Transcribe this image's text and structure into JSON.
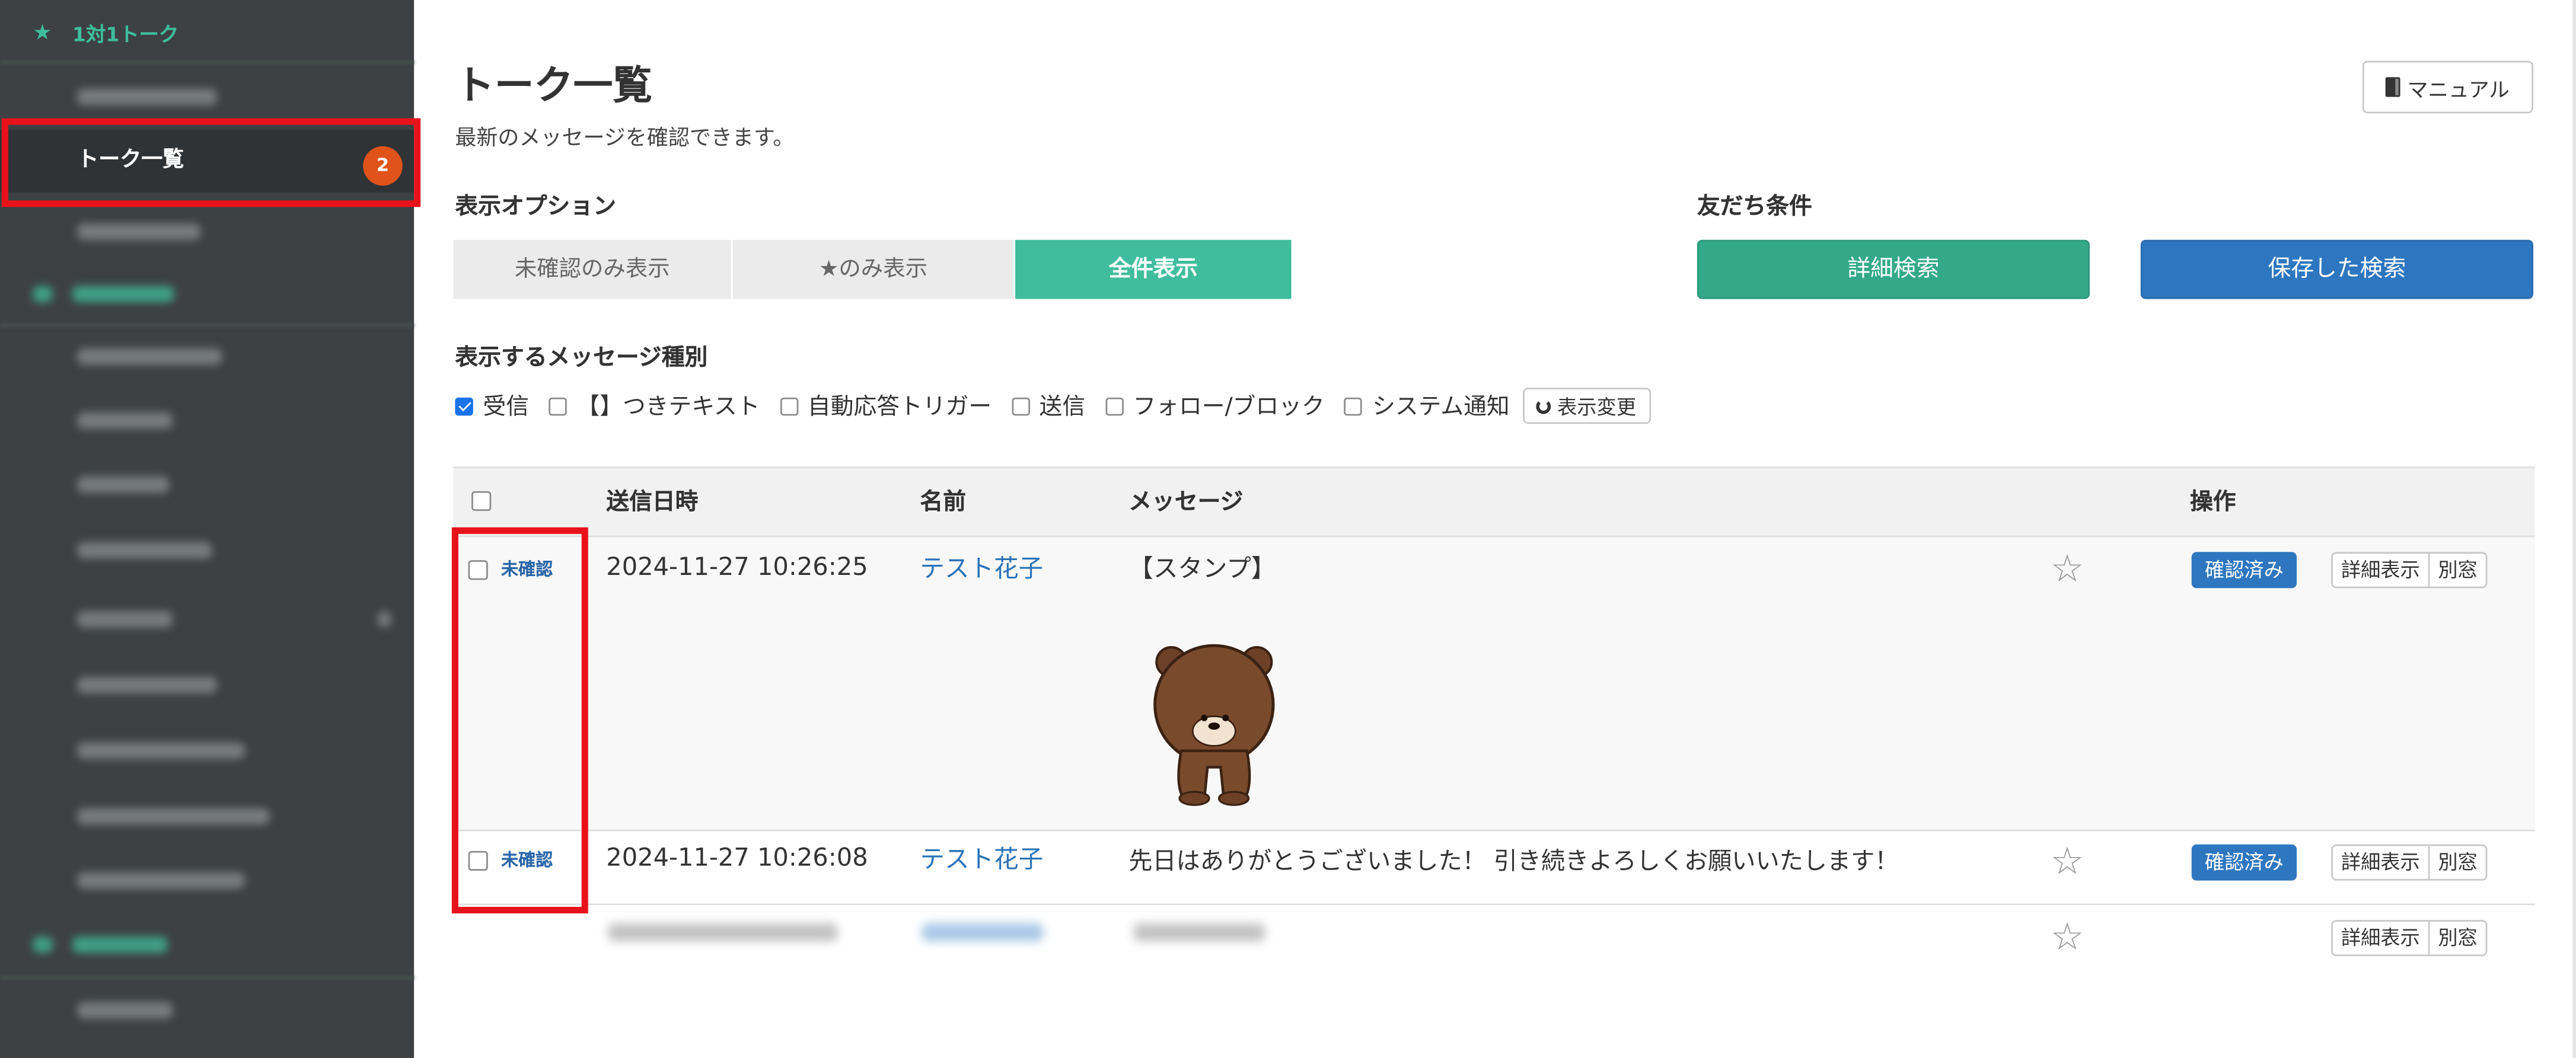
{
  "sidebar": {
    "section_title": "1対1トーク",
    "active_item": "トーク一覧",
    "active_badge": "2",
    "accent_color": "#3fbd9c"
  },
  "header": {
    "title": "トーク一覧",
    "subtitle": "最新のメッセージを確認できます。",
    "manual_button": "マニュアル"
  },
  "display_options": {
    "label": "表示オプション",
    "segments": [
      "未確認のみ表示",
      "★のみ表示",
      "全件表示"
    ],
    "active_segment": "全件表示"
  },
  "friend_conditions": {
    "label": "友だち条件",
    "detail_search": "詳細検索",
    "saved_search": "保存した検索"
  },
  "message_types": {
    "label": "表示するメッセージ種別",
    "items": [
      {
        "label": "受信",
        "checked": true
      },
      {
        "label": "【】つきテキスト",
        "checked": false
      },
      {
        "label": "自動応答トリガー",
        "checked": false
      },
      {
        "label": "送信",
        "checked": false
      },
      {
        "label": "フォロー/ブロック",
        "checked": false
      },
      {
        "label": "システム通知",
        "checked": false
      }
    ],
    "apply_button": "表示変更"
  },
  "table": {
    "headers": {
      "sent_at": "送信日時",
      "name": "名前",
      "message": "メッセージ",
      "actions": "操作"
    },
    "rows": [
      {
        "status": "未確認",
        "sent_at": "2024-11-27 10:26:25",
        "name": "テスト花子",
        "message": "【スタンプ】",
        "sticker": "bear-sticker",
        "confirm_label": "確認済み",
        "detail_label": "詳細表示",
        "window_label": "別窓"
      },
      {
        "status": "未確認",
        "sent_at": "2024-11-27 10:26:08",
        "name": "テスト花子",
        "message": "先日はありがとうございました！ 引き続きよろしくお願いいたします！",
        "confirm_label": "確認済み",
        "detail_label": "詳細表示",
        "window_label": "別窓"
      },
      {
        "detail_label": "詳細表示",
        "window_label": "別窓"
      }
    ]
  },
  "colors": {
    "sidebar_bg": "#3d4143",
    "highlight_red": "#e8121b",
    "badge_orange": "#e0531b",
    "primary_blue": "#2e77c0",
    "green": "#34a98a"
  }
}
